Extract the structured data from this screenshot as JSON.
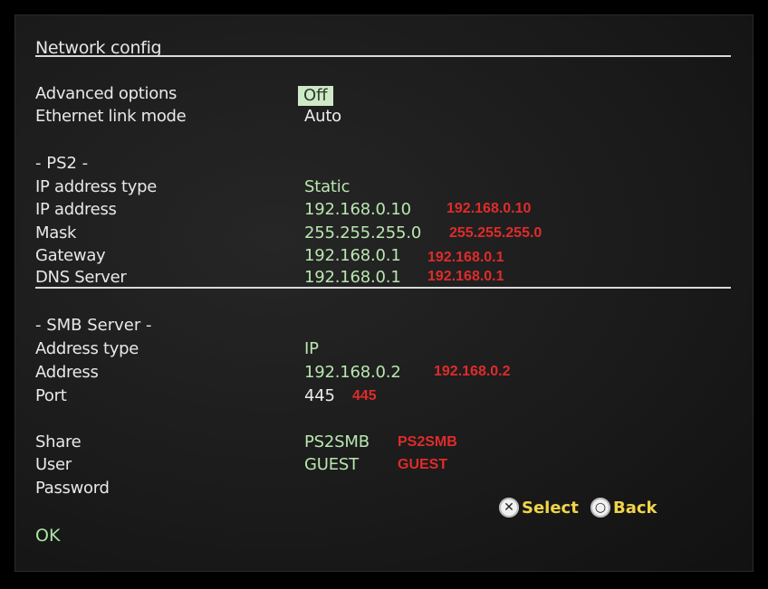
{
  "header": {
    "title": "Network config"
  },
  "general": {
    "advanced_options": {
      "label": "Advanced options",
      "value": "Off"
    },
    "ethernet_link_mode": {
      "label": "Ethernet link mode",
      "value": "Auto"
    }
  },
  "ps2": {
    "section_label": "- PS2 -",
    "ip_address_type": {
      "label": "IP address type",
      "value": "Static"
    },
    "ip_address": {
      "label": "IP address",
      "value": "192.168.0.10",
      "annotation": "192.168.0.10"
    },
    "mask": {
      "label": "Mask",
      "value": "255.255.255.0",
      "annotation": "255.255.255.0"
    },
    "gateway": {
      "label": "Gateway",
      "value": "192.168.0.1",
      "annotation": "192.168.0.1"
    },
    "dns_server": {
      "label": "DNS Server",
      "value": "192.168.0.1",
      "annotation": "192.168.0.1"
    }
  },
  "smb": {
    "section_label": "- SMB Server -",
    "address_type": {
      "label": "Address type",
      "value": "IP"
    },
    "address": {
      "label": "Address",
      "value": "192.168.0.2",
      "annotation": "192.168.0.2"
    },
    "port": {
      "label": "Port",
      "value": "445",
      "annotation": "445"
    },
    "share": {
      "label": "Share",
      "value": "PS2SMB",
      "annotation": "PS2SMB"
    },
    "user": {
      "label": "User",
      "value": "GUEST",
      "annotation": "GUEST"
    },
    "password": {
      "label": "Password"
    }
  },
  "footer": {
    "ok_label": "OK",
    "select_label": "Select",
    "back_label": "Back",
    "select_glyph": "✕",
    "back_glyph": "○"
  },
  "colors": {
    "annotation": "#e02b2b",
    "value_green": "#b9e6b0",
    "value_white": "#ececec",
    "hint_yellow": "#f0d44a"
  }
}
